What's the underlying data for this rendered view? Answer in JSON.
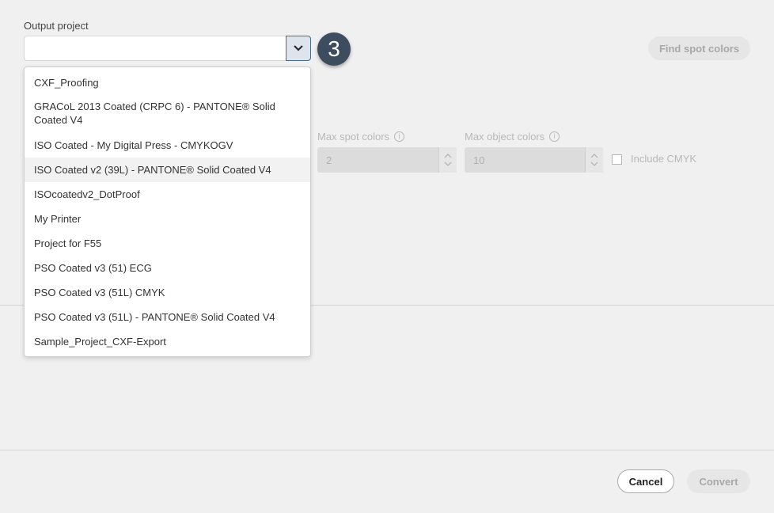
{
  "output_project": {
    "label": "Output project",
    "value": "",
    "step_badge": "3",
    "options": [
      "CXF_Proofing",
      "GRACoL 2013 Coated (CRPC 6) - PANTONE® Solid Coated V4",
      "ISO Coated - My Digital Press - CMYKOGV",
      "ISO Coated v2 (39L) - PANTONE® Solid Coated V4",
      "ISOcoatedv2_DotProof",
      "My Printer",
      "Project for F55",
      "PSO Coated v3 (51) ECG",
      "PSO Coated v3 (51L) CMYK",
      "PSO Coated v3 (51L) - PANTONE® Solid Coated V4",
      "Sample_Project_CXF-Export"
    ],
    "hovered_option": "ISO Coated v2 (39L) - PANTONE® Solid Coated V4"
  },
  "find_spot_colors_label": "Find spot colors",
  "max_spot_colors": {
    "label": "Max spot colors",
    "value": "2"
  },
  "max_object_colors": {
    "label": "Max object colors",
    "value": "10"
  },
  "include_cmyk": {
    "label": "Include CMYK",
    "checked": false
  },
  "footer": {
    "cancel_label": "Cancel",
    "convert_label": "Convert"
  },
  "icons": {
    "dropdown": "chevron-down-icon",
    "info": "info-icon",
    "spin_up": "chevron-up-icon",
    "spin_down": "chevron-down-icon"
  },
  "colors": {
    "badge": "#3d4d5f",
    "toggle_border": "#4a6b8c",
    "disabled_text": "#a8a8a8",
    "background": "#f0f0f0"
  }
}
